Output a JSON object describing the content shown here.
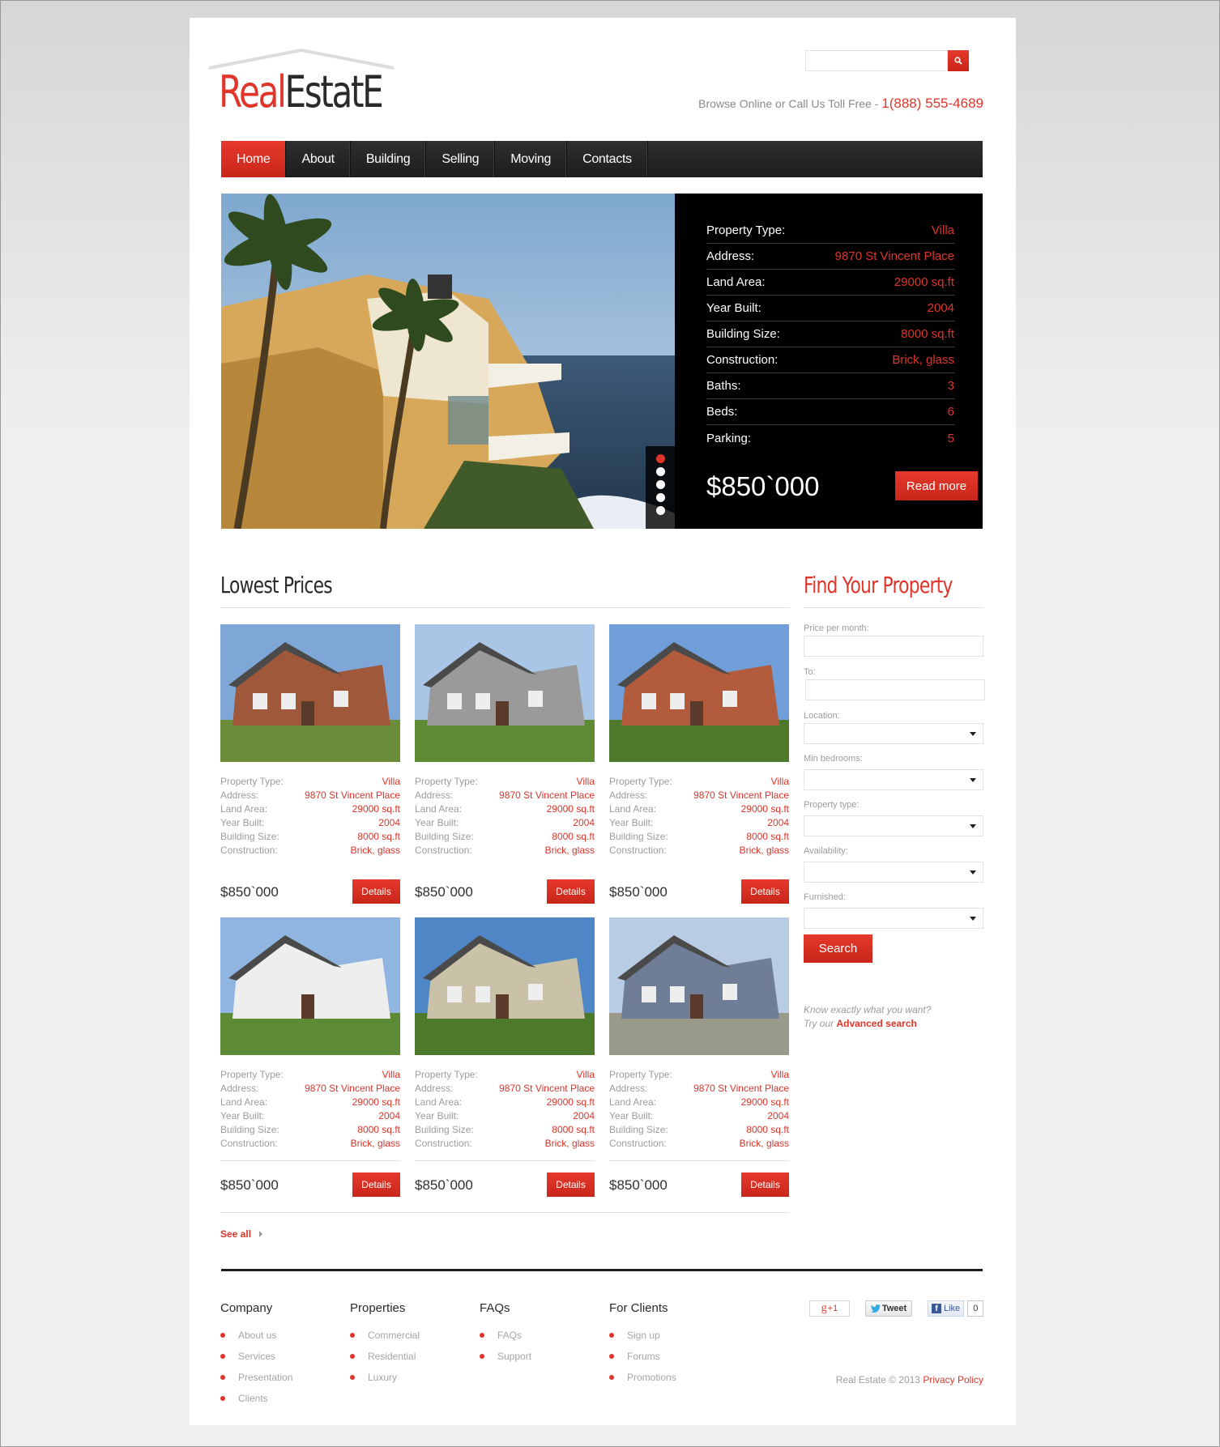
{
  "brand": {
    "logo_part1": "Real",
    "logo_part2": "EstatE",
    "accent_color": "#e0352b"
  },
  "header": {
    "search_placeholder": "",
    "search_icon": "search-icon",
    "tollfree_text": "Browse Online or Call Us Toll Free - ",
    "phone": "1(888) 555-4689"
  },
  "nav": {
    "items": [
      {
        "label": "Home",
        "active": true
      },
      {
        "label": "About"
      },
      {
        "label": "Building"
      },
      {
        "label": "Selling"
      },
      {
        "label": "Moving"
      },
      {
        "label": "Contacts"
      }
    ]
  },
  "hero": {
    "specs": [
      {
        "label": "Property Type:",
        "value": "Villa"
      },
      {
        "label": "Address:",
        "value": "9870 St Vincent Place"
      },
      {
        "label": "Land Area:",
        "value": "29000 sq.ft"
      },
      {
        "label": "Year Built:",
        "value": "2004"
      },
      {
        "label": "Building Size:",
        "value": "8000 sq.ft"
      },
      {
        "label": "Construction:",
        "value": "Brick, glass"
      },
      {
        "label": "Baths:",
        "value": "3"
      },
      {
        "label": "Beds:",
        "value": "6"
      },
      {
        "label": "Parking:",
        "value": "5"
      }
    ],
    "price": "$850`000",
    "read_more": "Read more",
    "slides_total": 5,
    "slide_active": 1
  },
  "lowest_prices": {
    "title": "Lowest Prices",
    "see_all": "See all",
    "cards": [
      {
        "specs": [
          {
            "k": "Property Type:",
            "v": "Villa"
          },
          {
            "k": "Address:",
            "v": "9870 St Vincent Place"
          },
          {
            "k": "Land Area:",
            "v": "29000 sq.ft"
          },
          {
            "k": "Year Built:",
            "v": "2004"
          },
          {
            "k": "Building Size:",
            "v": "8000 sq.ft"
          },
          {
            "k": "Construction:",
            "v": "Brick, glass"
          }
        ],
        "price": "$850`000",
        "button": "Details"
      },
      {
        "specs": [
          {
            "k": "Property Type:",
            "v": "Villa"
          },
          {
            "k": "Address:",
            "v": "9870 St Vincent Place"
          },
          {
            "k": "Land Area:",
            "v": "29000 sq.ft"
          },
          {
            "k": "Year Built:",
            "v": "2004"
          },
          {
            "k": "Building Size:",
            "v": "8000 sq.ft"
          },
          {
            "k": "Construction:",
            "v": "Brick, glass"
          }
        ],
        "price": "$850`000",
        "button": "Details"
      },
      {
        "specs": [
          {
            "k": "Property Type:",
            "v": "Villa"
          },
          {
            "k": "Address:",
            "v": "9870 St Vincent Place"
          },
          {
            "k": "Land Area:",
            "v": "29000 sq.ft"
          },
          {
            "k": "Year Built:",
            "v": "2004"
          },
          {
            "k": "Building Size:",
            "v": "8000 sq.ft"
          },
          {
            "k": "Construction:",
            "v": "Brick, glass"
          }
        ],
        "price": "$850`000",
        "button": "Details"
      },
      {
        "specs": [
          {
            "k": "Property Type:",
            "v": "Villa"
          },
          {
            "k": "Address:",
            "v": "9870 St Vincent Place"
          },
          {
            "k": "Land Area:",
            "v": "29000 sq.ft"
          },
          {
            "k": "Year Built:",
            "v": "2004"
          },
          {
            "k": "Building Size:",
            "v": "8000 sq.ft"
          },
          {
            "k": "Construction:",
            "v": "Brick, glass"
          }
        ],
        "price": "$850`000",
        "button": "Details"
      },
      {
        "specs": [
          {
            "k": "Property Type:",
            "v": "Villa"
          },
          {
            "k": "Address:",
            "v": "9870 St Vincent Place"
          },
          {
            "k": "Land Area:",
            "v": "29000 sq.ft"
          },
          {
            "k": "Year Built:",
            "v": "2004"
          },
          {
            "k": "Building Size:",
            "v": "8000 sq.ft"
          },
          {
            "k": "Construction:",
            "v": "Brick, glass"
          }
        ],
        "price": "$850`000",
        "button": "Details"
      },
      {
        "specs": [
          {
            "k": "Property Type:",
            "v": "Villa"
          },
          {
            "k": "Address:",
            "v": "9870 St Vincent Place"
          },
          {
            "k": "Land Area:",
            "v": "29000 sq.ft"
          },
          {
            "k": "Year Built:",
            "v": "2004"
          },
          {
            "k": "Building Size:",
            "v": "8000 sq.ft"
          },
          {
            "k": "Construction:",
            "v": "Brick, glass"
          }
        ],
        "price": "$850`000",
        "button": "Details"
      }
    ]
  },
  "find_property": {
    "title": "Find Your Property",
    "fields": [
      {
        "label": "Price per month:",
        "type": "input",
        "value": ""
      },
      {
        "label": "To:",
        "type": "input",
        "value": ""
      },
      {
        "label": "Location:",
        "type": "select",
        "value": ""
      },
      {
        "label": "Min bedrooms:",
        "type": "select",
        "value": ""
      },
      {
        "label": "Property type:",
        "type": "select",
        "value": ""
      },
      {
        "label": "Availability:",
        "type": "select",
        "value": ""
      },
      {
        "label": "Furnished:",
        "type": "select",
        "value": ""
      }
    ],
    "search_button": "Search",
    "know_line1": "Know exactly what you want?",
    "know_line2_prefix": "Try our ",
    "advanced_link": "Advanced search"
  },
  "footer": {
    "columns": [
      {
        "title": "Company",
        "items": [
          "About us",
          "Services",
          "Presentation",
          "Clients"
        ]
      },
      {
        "title": "Properties",
        "items": [
          "Commercial",
          "Residential",
          "Luxury"
        ]
      },
      {
        "title": "FAQs",
        "items": [
          "FAQs",
          "Support"
        ]
      },
      {
        "title": "For Clients",
        "items": [
          "Sign up",
          "Forums",
          "Promotions"
        ]
      }
    ],
    "social": {
      "gplus": "+1",
      "tweet": "Tweet",
      "like": "Like",
      "like_count": "0"
    },
    "copyright": "Real Estate © 2013 ",
    "privacy": "Privacy Policy"
  }
}
